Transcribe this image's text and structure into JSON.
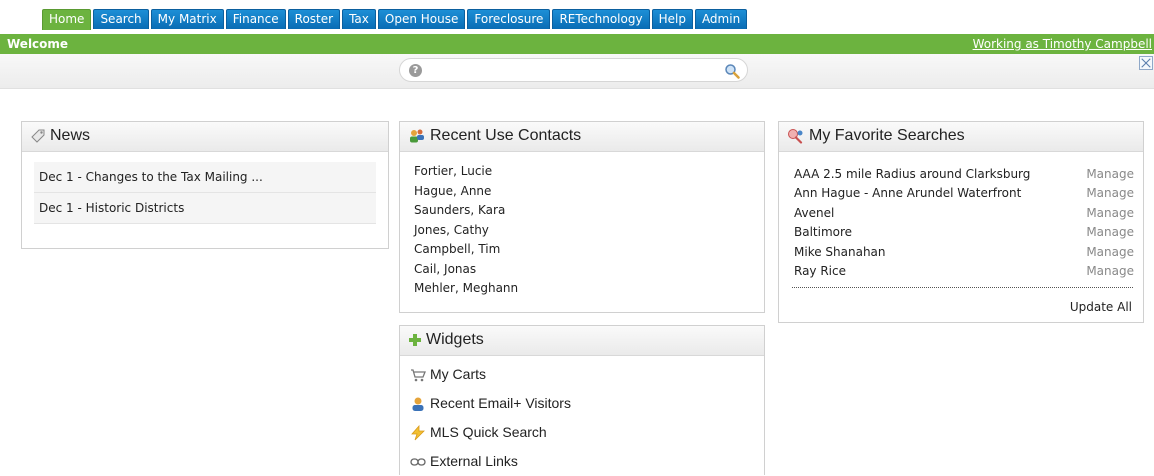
{
  "nav": {
    "tabs": [
      "Home",
      "Search",
      "My Matrix",
      "Finance",
      "Roster",
      "Tax",
      "Open House",
      "Foreclosure",
      "RETechnology",
      "Help",
      "Admin"
    ],
    "active": "Home",
    "welcome": "Welcome",
    "working_as": "Working as Timothy Campbell"
  },
  "search": {
    "value": "",
    "placeholder": ""
  },
  "news": {
    "title": "News",
    "items": [
      "Dec 1 - Changes to the Tax Mailing ...",
      "Dec 1 - Historic Districts"
    ]
  },
  "contacts": {
    "title": "Recent Use Contacts",
    "items": [
      "Fortier, Lucie",
      "Hague, Anne",
      "Saunders, Kara",
      "Jones, Cathy",
      "Campbell, Tim",
      "Cail, Jonas",
      "Mehler, Meghann"
    ]
  },
  "widgets": {
    "title": "Widgets",
    "items": [
      {
        "label": "My Carts",
        "icon": "cart-icon"
      },
      {
        "label": "Recent Email+ Visitors",
        "icon": "person-icon"
      },
      {
        "label": "MLS Quick Search",
        "icon": "lightning-icon"
      },
      {
        "label": "External Links",
        "icon": "chain-link-icon"
      }
    ]
  },
  "favorites": {
    "title": "My Favorite Searches",
    "manage_label": "Manage",
    "items": [
      "AAA 2.5 mile Radius around Clarksburg",
      "Ann Hague - Anne Arundel Waterfront",
      "Avenel",
      "Baltimore",
      "Mike Shanahan",
      "Ray Rice"
    ],
    "update_all": "Update All"
  },
  "colors": {
    "nav_green": "#6cb33f",
    "tab_blue": "#0a6cb4"
  }
}
